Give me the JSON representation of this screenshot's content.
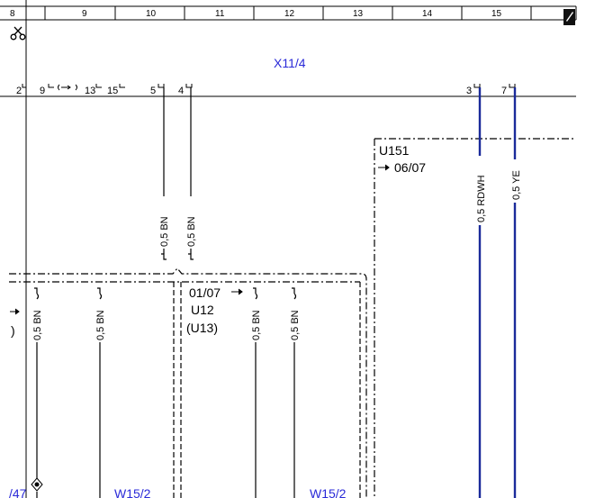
{
  "grid": {
    "column_numbers": [
      "8",
      "9",
      "10",
      "11",
      "12",
      "13",
      "14",
      "15"
    ]
  },
  "connector": {
    "label": "X11/4",
    "pins_left": [
      "2",
      "9",
      "13",
      "15",
      "5",
      "4"
    ],
    "pins_right": [
      "3",
      "7"
    ]
  },
  "wires": {
    "upper_left_1": "0,5 BN",
    "upper_left_2": "0,5 BN",
    "lower_1": "0,5 BN",
    "lower_2": "0,5 BN",
    "lower_3": "0,5 BN",
    "lower_4": "0,5 BN",
    "right_1": "0,5 RDWH",
    "right_2": "0,5 YE"
  },
  "modules": {
    "u12_date": "01/07",
    "u12_label": "U12",
    "u12_alt": "(U13)",
    "u151_label": "U151",
    "u151_date": "06/07",
    "left_paren": ")"
  },
  "refs": {
    "left_bottom": "/47",
    "w15_a": "W15/2",
    "w15_b": "W15/2"
  },
  "icons": {
    "cut": "scissors-icon",
    "corner": "pencil-icon"
  },
  "colors": {
    "wire_blue": "#1a2a9a",
    "text_blue": "#2a2ad8"
  }
}
